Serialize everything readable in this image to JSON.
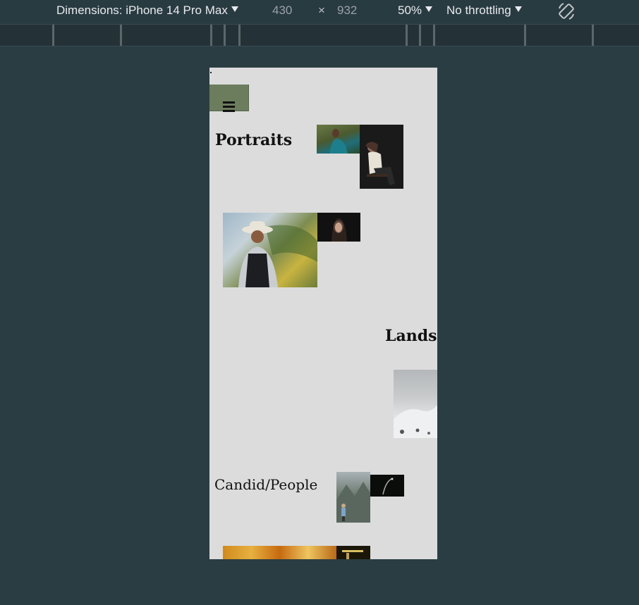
{
  "toolbar": {
    "dimensions_label": "Dimensions: iPhone 14 Pro Max",
    "width_value": "430",
    "times_symbol": "×",
    "height_value": "932",
    "zoom": "50%",
    "throttling": "No throttling"
  },
  "nav": {
    "menu_icon": "hamburger-icon"
  },
  "sections": {
    "portraits_title": "Portraits",
    "landscape_title": "Landsc",
    "candid_title": "Candid/People"
  },
  "photos": [
    "portrait-woman-teal-dress",
    "portrait-woman-chair-dark",
    "portrait-man-cowboy-hat",
    "portrait-woman-black-bg",
    "landscape-snowy-slope",
    "candid-hiker-mountains",
    "candid-dark-night",
    "candid-autumn-trees",
    "candid-dark-lights"
  ]
}
